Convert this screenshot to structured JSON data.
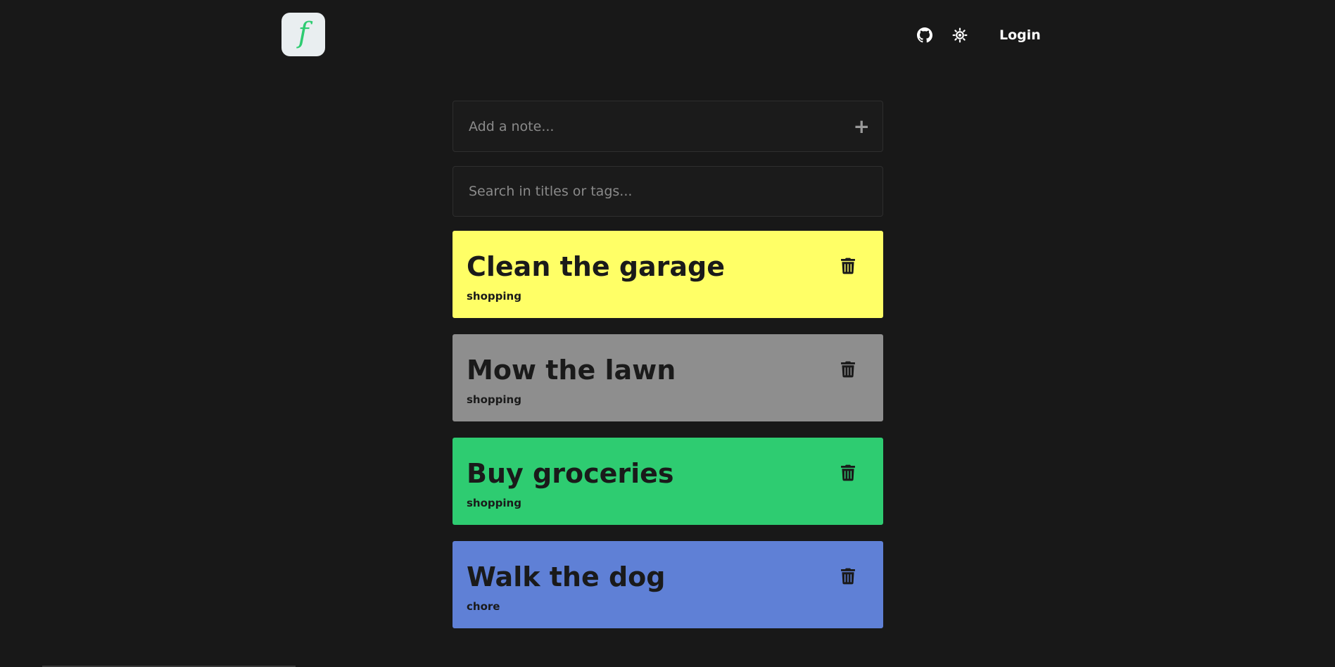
{
  "header": {
    "logo_text": "f",
    "logo_color": "#2ecc71",
    "github_icon": "github-icon",
    "theme_icon": "sun-icon",
    "login_label": "Login"
  },
  "add_note": {
    "placeholder": "Add a note...",
    "value": "",
    "add_icon": "plus-icon"
  },
  "search": {
    "placeholder": "Search in titles or tags...",
    "value": ""
  },
  "notes": [
    {
      "title": "Clean the garage",
      "tag": "shopping",
      "color": "#ffff66"
    },
    {
      "title": "Mow the lawn",
      "tag": "shopping",
      "color": "#8e8e8e"
    },
    {
      "title": "Buy groceries",
      "tag": "shopping",
      "color": "#2ecc71"
    },
    {
      "title": "Walk the dog",
      "tag": "chore",
      "color": "#5f80d6"
    }
  ]
}
